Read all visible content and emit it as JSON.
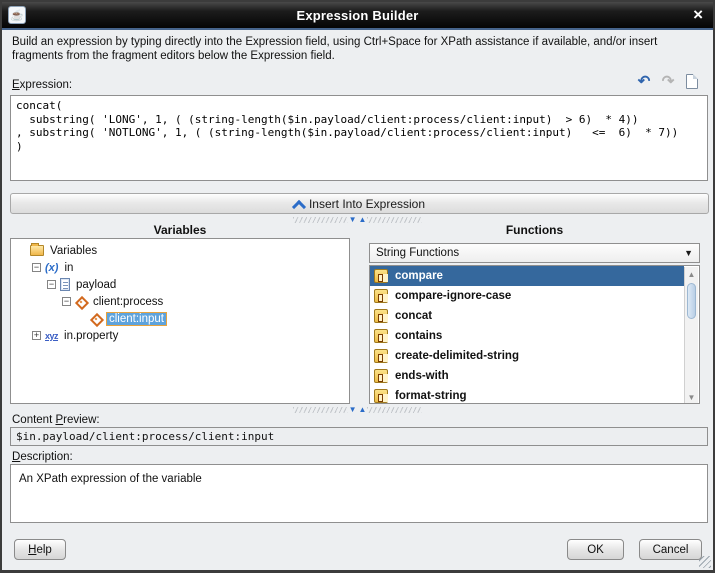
{
  "window": {
    "title": "Expression Builder",
    "close_glyph": "×",
    "app_icon_glyph": "☕"
  },
  "instructions": "Build an expression by typing directly into the Expression field, using Ctrl+Space for XPath assistance if available, and/or insert fragments from the fragment editors below the Expression field.",
  "expression": {
    "label_pre": "",
    "label_mn": "E",
    "label_post": "xpression:",
    "value": "concat(\n  substring( 'LONG', 1, ( (string-length($in.payload/client:process/client:input)  > 6)  * 4))\n, substring( 'NOTLONG', 1, ( (string-length($in.payload/client:process/client:input)   <=  6)  * 7))\n)",
    "toolbar": {
      "undo_glyph": "↶",
      "redo_glyph": "↷"
    }
  },
  "insert_button": {
    "label": "Insert Into Expression"
  },
  "variables": {
    "header": "Variables",
    "tree": [
      {
        "label": "Variables",
        "icon": "folder",
        "level": 0,
        "expander": "none",
        "selected": false
      },
      {
        "label": "in",
        "icon": "x",
        "level": 1,
        "expander": "minus",
        "selected": false
      },
      {
        "label": "payload",
        "icon": "doc",
        "level": 2,
        "expander": "minus",
        "selected": false
      },
      {
        "label": "client:process",
        "icon": "elem",
        "level": 3,
        "expander": "minus",
        "selected": false
      },
      {
        "label": "client:input",
        "icon": "elem",
        "level": 4,
        "expander": "leaf",
        "selected": true
      },
      {
        "label": "in.property",
        "icon": "xyz",
        "level": 1,
        "expander": "plus",
        "selected": false
      }
    ]
  },
  "functions": {
    "header": "Functions",
    "category_selected": "String Functions",
    "items": [
      {
        "label": "compare",
        "selected": true
      },
      {
        "label": "compare-ignore-case",
        "selected": false
      },
      {
        "label": "concat",
        "selected": false
      },
      {
        "label": "contains",
        "selected": false
      },
      {
        "label": "create-delimited-string",
        "selected": false
      },
      {
        "label": "ends-with",
        "selected": false
      },
      {
        "label": "format-string",
        "selected": false
      }
    ]
  },
  "content_preview": {
    "label_pre": "Content ",
    "label_mn": "P",
    "label_post": "review:",
    "value": "$in.payload/client:process/client:input"
  },
  "description": {
    "label_pre": "",
    "label_mn": "D",
    "label_post": "escription:",
    "value": "An XPath expression of the variable"
  },
  "buttons": {
    "help_mn": "H",
    "help_rest": "elp",
    "ok": "OK",
    "cancel": "Cancel"
  },
  "colors": {
    "selection_blue": "#35689d",
    "tree_selection_fill": "#5ea3dc",
    "tree_selection_border": "#e8a33d",
    "accent_blue": "#2b6cc8",
    "title_accent": "#46648c",
    "element_orange": "#d2691e",
    "function_icon_gold": "#edbc45"
  }
}
